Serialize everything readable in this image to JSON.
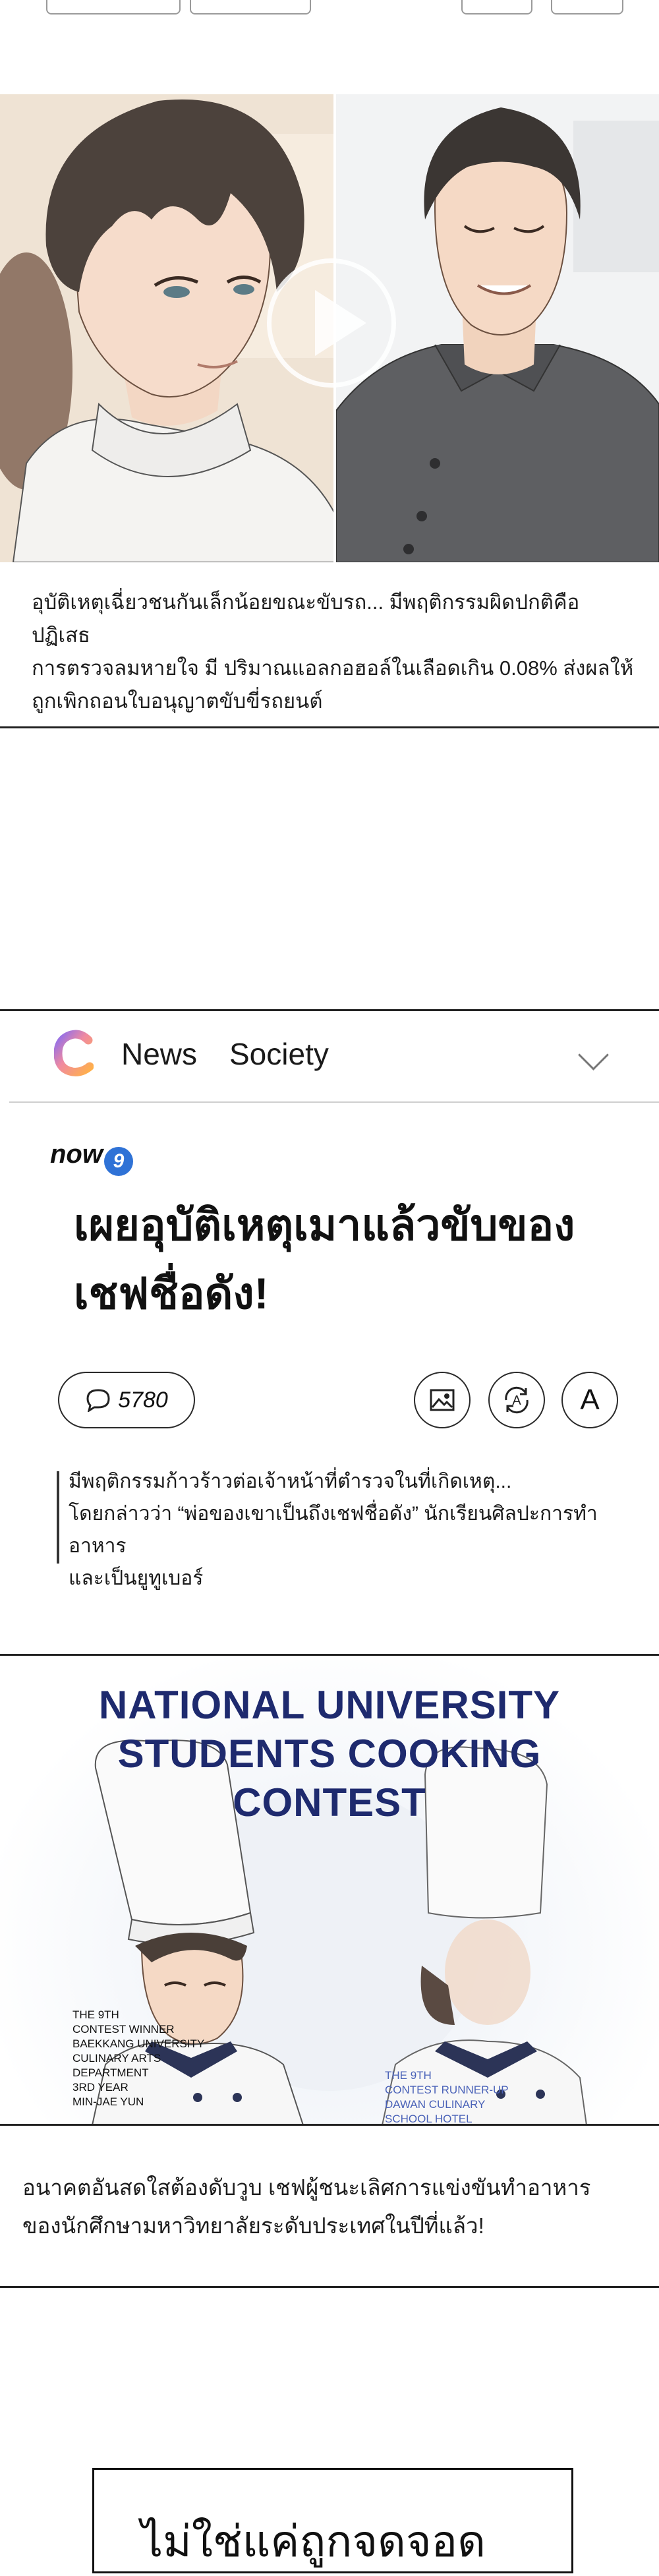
{
  "panel1": {
    "caption_line1": "อุบัติเหตุเฉี่ยวชนกันเล็กน้อยขณะขับรถ... มีพฤติกรรมผิดปกติคือปฏิเสธ",
    "caption_line2": "การตรวจลมหายใจ มี ปริมาณแอลกอฮอล์ในเลือดเกิน 0.08% ส่งผลให้",
    "caption_line3": "ถูกเพิกถอนใบอนุญาตขับขี่รถยนต์"
  },
  "news_card": {
    "nav_news": "News",
    "nav_society": "Society",
    "brand_now": "now",
    "brand_nine": "9",
    "headline_line1": "เผยอุบัติเหตุเมาแล้วขับของ",
    "headline_line2": "เชฟชื่อดัง!",
    "comment_count": "5780",
    "font_button_label": "A",
    "summary_line1": "มีพฤติกรรมก้าวร้าวต่อเจ้าหน้าที่ตำรวจในที่เกิดเหตุ...",
    "summary_line2": "โดยกล่าวว่า “พ่อของเขาเป็นถึงเชฟชื่อดัง” นักเรียนศิลปะการทำอาหาร",
    "summary_line3": "และเป็นยูทูเบอร์"
  },
  "panel2": {
    "contest_line1": "NATIONAL UNIVERSITY",
    "contest_line2": "STUDENTS COOKING",
    "contest_line3": "CONTEST",
    "left_info": [
      "THE 9TH",
      "CONTEST WINNER",
      "BAEKKANG UNIVERSITY",
      "CULINARY ARTS",
      "DEPARTMENT",
      "3RD YEAR",
      "MIN-JAE YUN"
    ],
    "right_info": [
      "THE 9TH",
      "CONTEST RUNNER-UP",
      "DAWAN CULINARY",
      "SCHOOL HOTEL"
    ],
    "caption_line1": "อนาคตอันสดใสต้องดับวูบ เชฟผู้ชนะเลิศการแข่งขันทำอาหาร",
    "caption_line2": "ของนักศึกษามหาวิทยาลัยระดับประเทศในปีที่แล้ว!"
  },
  "bottom_box": {
    "text": "ไม่ใช่แค่ถูกจดจอด"
  },
  "colors": {
    "contest_title": "#1e2a6e",
    "brand_nine_bg": "#2f72d6",
    "rule": "#222222"
  }
}
